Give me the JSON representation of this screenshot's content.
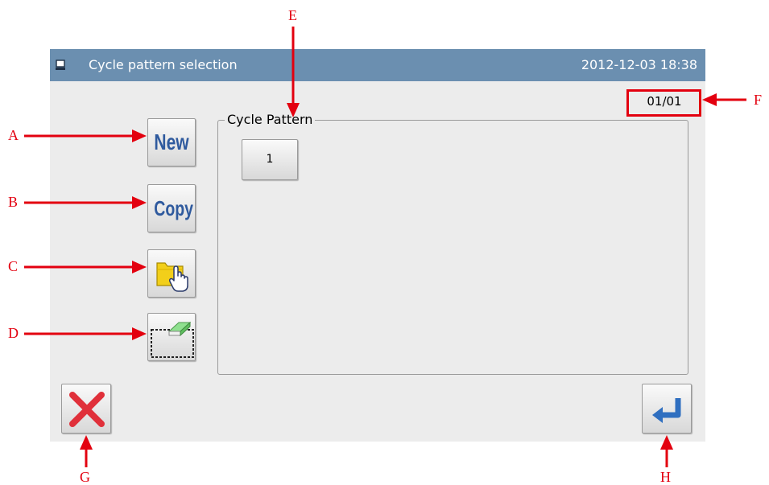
{
  "titlebar": {
    "title": "Cycle pattern selection",
    "datetime": "2012-12-03  18:38",
    "bg_color": "#6b8fb0"
  },
  "page_indicator": "01/01",
  "toolbar": {
    "new_label": "New",
    "copy_label": "Copy",
    "open_icon": "folder-hand-icon",
    "clear_icon": "eraser-selection-icon"
  },
  "group": {
    "title": "Cycle Pattern",
    "patterns": [
      "1"
    ]
  },
  "footer": {
    "cancel_icon": "cancel-x-icon",
    "enter_icon": "enter-return-icon"
  },
  "annotations": {
    "labels": [
      "A",
      "B",
      "C",
      "D",
      "E",
      "F",
      "G",
      "H"
    ],
    "color": "#e3000f"
  }
}
